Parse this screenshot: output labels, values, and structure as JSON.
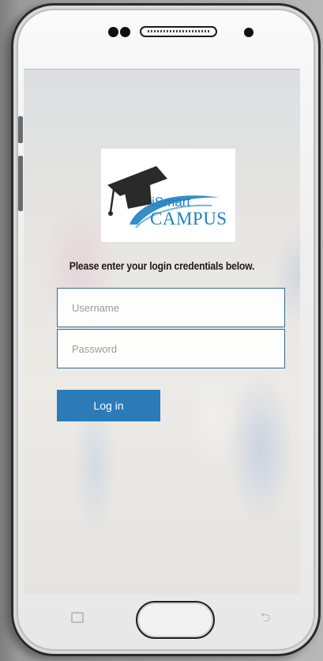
{
  "logo": {
    "brand_line1": "iSmart",
    "brand_line2": "CAMPUS"
  },
  "login": {
    "instruction": "Please enter your login credentials below.",
    "username_placeholder": "Username",
    "password_placeholder": "Password",
    "login_label": "Log in"
  },
  "colors": {
    "primary_button": "#2b7bb8",
    "input_border": "#2e6d8e",
    "logo_blue": "#1f7fc0"
  },
  "icons": {
    "recent_apps": "recent-apps-icon",
    "home": "home-button",
    "back": "back-icon",
    "logo": "graduation-cap-icon"
  }
}
